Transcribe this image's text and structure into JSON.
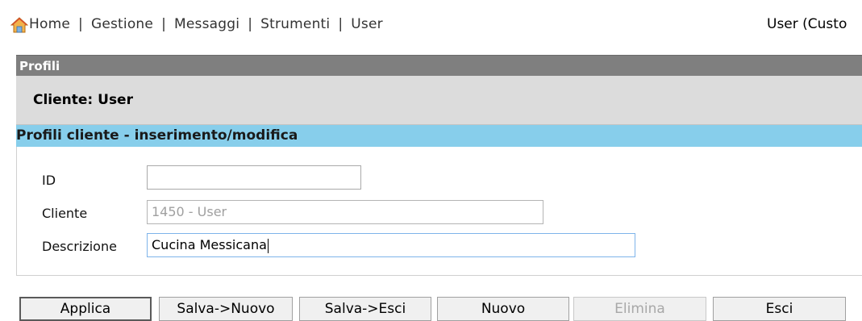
{
  "topnav": {
    "links": [
      "Home",
      "Gestione",
      "Messaggi",
      "Strumenti",
      "User"
    ],
    "separator": "|",
    "user_info": "User (Custo"
  },
  "panel": {
    "title": "Profili",
    "cliente_label": "Cliente: User"
  },
  "section": {
    "title": "Profili cliente - inserimento/modifica"
  },
  "form": {
    "id": {
      "label": "ID",
      "value": ""
    },
    "cliente": {
      "label": "Cliente",
      "value": "1450 - User"
    },
    "descrizione": {
      "label": "Descrizione",
      "value": "Cucina Messicana"
    }
  },
  "buttons": {
    "applica": "Applica",
    "salva_nuovo": "Salva->Nuovo",
    "salva_esci": "Salva->Esci",
    "nuovo": "Nuovo",
    "elimina": "Elimina",
    "esci": "Esci"
  },
  "colors": {
    "panel_header": "#7f7f7f",
    "cliente_bar": "#dcdcdc",
    "section_header": "#87ceeb"
  }
}
